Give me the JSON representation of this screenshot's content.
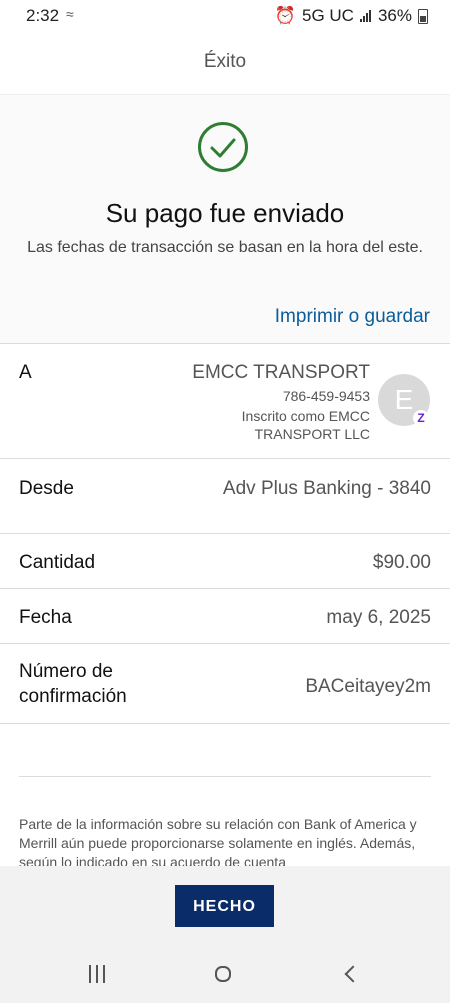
{
  "status_bar": {
    "time": "2:32",
    "network": "5G UC",
    "battery": "36%"
  },
  "header": {
    "title": "Éxito"
  },
  "confirmation": {
    "title": "Su pago fue enviado",
    "subtitle": "Las fechas de transacción se basan en la hora del este.",
    "print_link": "Imprimir o guardar",
    "success_color": "#2e7d32"
  },
  "details": {
    "to_label": "A",
    "recipient_name": "EMCC TRANSPORT",
    "recipient_phone": "786-459-9453",
    "registered_line1": "Inscrito como EMCC",
    "registered_line2": "TRANSPORT LLC",
    "avatar_initial": "E",
    "from_label": "Desde",
    "from_value": "Adv Plus Banking - 3840",
    "amount_label": "Cantidad",
    "amount_value": "$90.00",
    "date_label": "Fecha",
    "date_value": "may 6, 2025",
    "confirmation_label_line1": "Número de",
    "confirmation_label_line2": "confirmación",
    "confirmation_value": "BACeitayey2m"
  },
  "disclaimer": "Parte de la información sobre su relación con Bank of America y Merrill aún puede proporcionarse solamente en inglés. Además, según lo indicado en su acuerdo de cuenta",
  "actions": {
    "done_label": "HECHO",
    "done_color": "#0a2c68"
  },
  "icons": {
    "success": "check-circle-icon",
    "avatar_badge": "zelle-icon",
    "nav": [
      "recent-apps-icon",
      "home-icon",
      "back-icon"
    ]
  }
}
